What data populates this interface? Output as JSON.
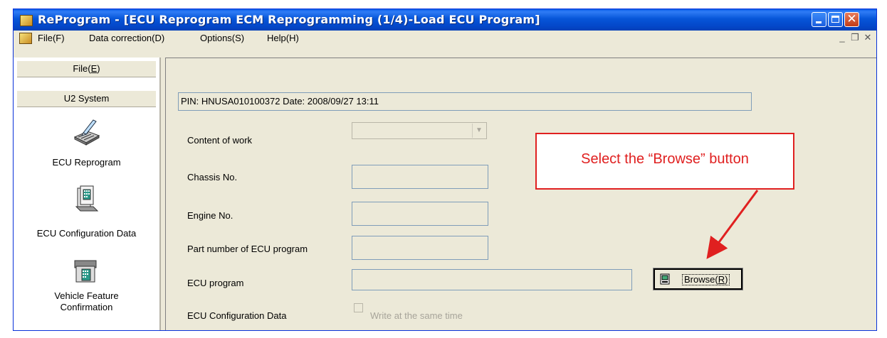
{
  "window": {
    "title": "ReProgram - [ECU Reprogram ECM Reprogramming (1/4)-Load ECU Program]"
  },
  "menubar": {
    "items": [
      "File(F)",
      "Data correction(D)",
      "Options(S)",
      "Help(H)"
    ]
  },
  "sidebar": {
    "header_file": "File(E)",
    "header_system": "U2 System",
    "items": [
      {
        "label": "ECU Reprogram",
        "icon": "ecu-reprogram-icon"
      },
      {
        "label": "ECU Configuration Data",
        "icon": "ecu-configuration-data-icon"
      },
      {
        "label_line1": "Vehicle Feature",
        "label_line2": "Confirmation",
        "icon": "vehicle-feature-icon"
      }
    ]
  },
  "form": {
    "pin_info": "PIN: HNUSA010100372  Date: 2008/09/27 13:11",
    "content_of_work_label": "Content of work",
    "chassis_no_label": "Chassis No.",
    "engine_no_label": "Engine No.",
    "part_number_label": "Part number of ECU program",
    "ecu_program_label": "ECU program",
    "ecu_config_label": "ECU Configuration Data",
    "write_same_time_label": "Write at the same time",
    "write_same_time_checked": false,
    "browse_button": "Browse(R)"
  },
  "annotation": {
    "callout_text": "Select the “Browse” button",
    "color": "#e02020"
  },
  "colors": {
    "titlebar": "#0655d8",
    "window_bg": "#ece9d8"
  }
}
